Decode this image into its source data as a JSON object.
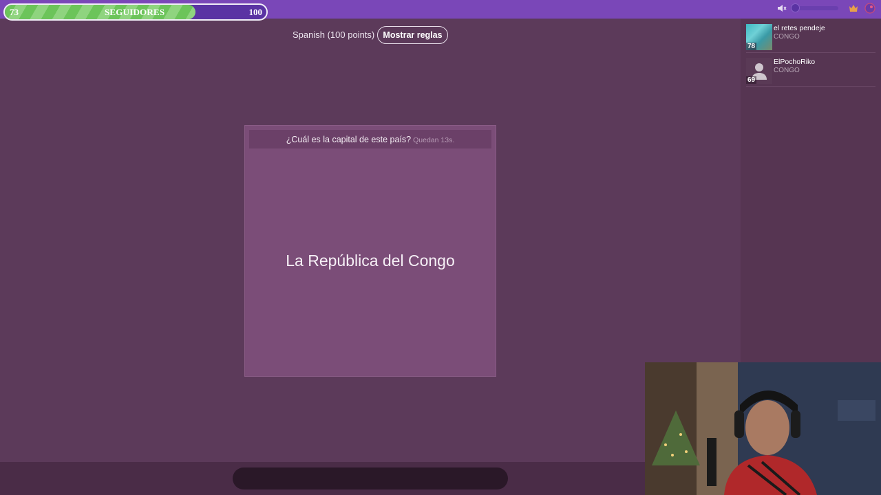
{
  "goal": {
    "current": "73",
    "label": "SEGUIDORES",
    "target": "100",
    "progress_fraction": 0.73
  },
  "topbar": {
    "icons": [
      "mute-icon",
      "volume-slider",
      "crown-icon",
      "profile-icon"
    ],
    "accent": "#7a47b8"
  },
  "game": {
    "info": "Spanish (100 points)",
    "rules_button": "Mostrar reglas"
  },
  "question": {
    "prompt": "¿Cuál es la capital de este país?",
    "timer": "Quedan 13s.",
    "subject": "La República del Congo"
  },
  "players": [
    {
      "name": "el retes pendeje",
      "answer": "CONGO",
      "score": "78",
      "avatar": "photo"
    },
    {
      "name": "ElPochoRiko",
      "answer": "CONGO",
      "score": "69",
      "avatar": "default-user-icon"
    }
  ],
  "answer_input": {
    "value": "",
    "placeholder": ""
  },
  "colors": {
    "background": "#5c3a5a",
    "card": "#7b4d78",
    "goal_fill": "#6cc45a"
  }
}
